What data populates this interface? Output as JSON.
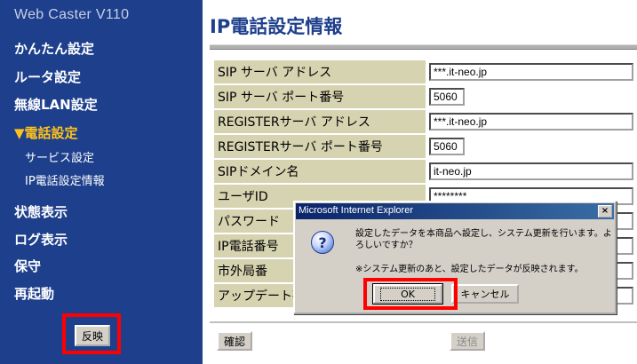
{
  "sidebar": {
    "brand": "Web Caster V110",
    "items": [
      {
        "label": "かんたん設定"
      },
      {
        "label": "ルータ設定"
      },
      {
        "label": "無線LAN設定"
      },
      {
        "label": "▼電話設定"
      },
      {
        "label": "サービス設定"
      },
      {
        "label": "IP電話設定情報"
      },
      {
        "label": "状態表示"
      },
      {
        "label": "ログ表示"
      },
      {
        "label": "保守"
      },
      {
        "label": "再起動"
      }
    ],
    "apply_label": "反映"
  },
  "main": {
    "title": "IP電話設定情報",
    "rows": [
      {
        "label": "SIP サーバ アドレス",
        "value": "***.it-neo.jp"
      },
      {
        "label": "SIP サーバ ポート番号",
        "value": "5060"
      },
      {
        "label": "REGISTERサーバ アドレス",
        "value": "***.it-neo.jp"
      },
      {
        "label": "REGISTERサーバ ポート番号",
        "value": "5060"
      },
      {
        "label": "SIPドメイン名",
        "value": "it-neo.jp"
      },
      {
        "label": "ユーザID",
        "value": "********"
      },
      {
        "label": "パスワード",
        "value": ""
      },
      {
        "label": "IP電話番号",
        "value": ""
      },
      {
        "label": "市外局番",
        "value": ""
      },
      {
        "label": "アップデート確",
        "value": ""
      }
    ],
    "confirm_label": "確認",
    "send_label": "送信"
  },
  "dialog": {
    "title": "Microsoft Internet Explorer",
    "close_symbol": "×",
    "icon_glyph": "?",
    "message": "設定したデータを本商品へ設定し、システム更新を行います。よろしいですか？",
    "note": "※システム更新のあと、設定したデータが反映されます。",
    "ok_label": "OK",
    "cancel_label": "キャンセル"
  },
  "colors": {
    "sidebar_bg": "#1d3f8c",
    "active_menu": "#ffc21a",
    "label_cell_bg": "#d6d3b1",
    "highlight": "#ff0000"
  }
}
